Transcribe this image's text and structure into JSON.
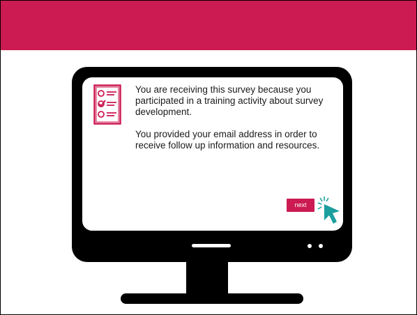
{
  "header": {
    "background_color": "#cc1a52"
  },
  "screen": {
    "icon": "survey-checklist-icon",
    "paragraphs": [
      "You are receiving this survey because you participated in a training activity about survey development.",
      "You provided your email address in order to receive follow up information and resources."
    ],
    "next_label": "next",
    "cursor_icon": "click-cursor-icon",
    "accent_color": "#cc1a52",
    "cursor_color": "#1b9e9e"
  }
}
